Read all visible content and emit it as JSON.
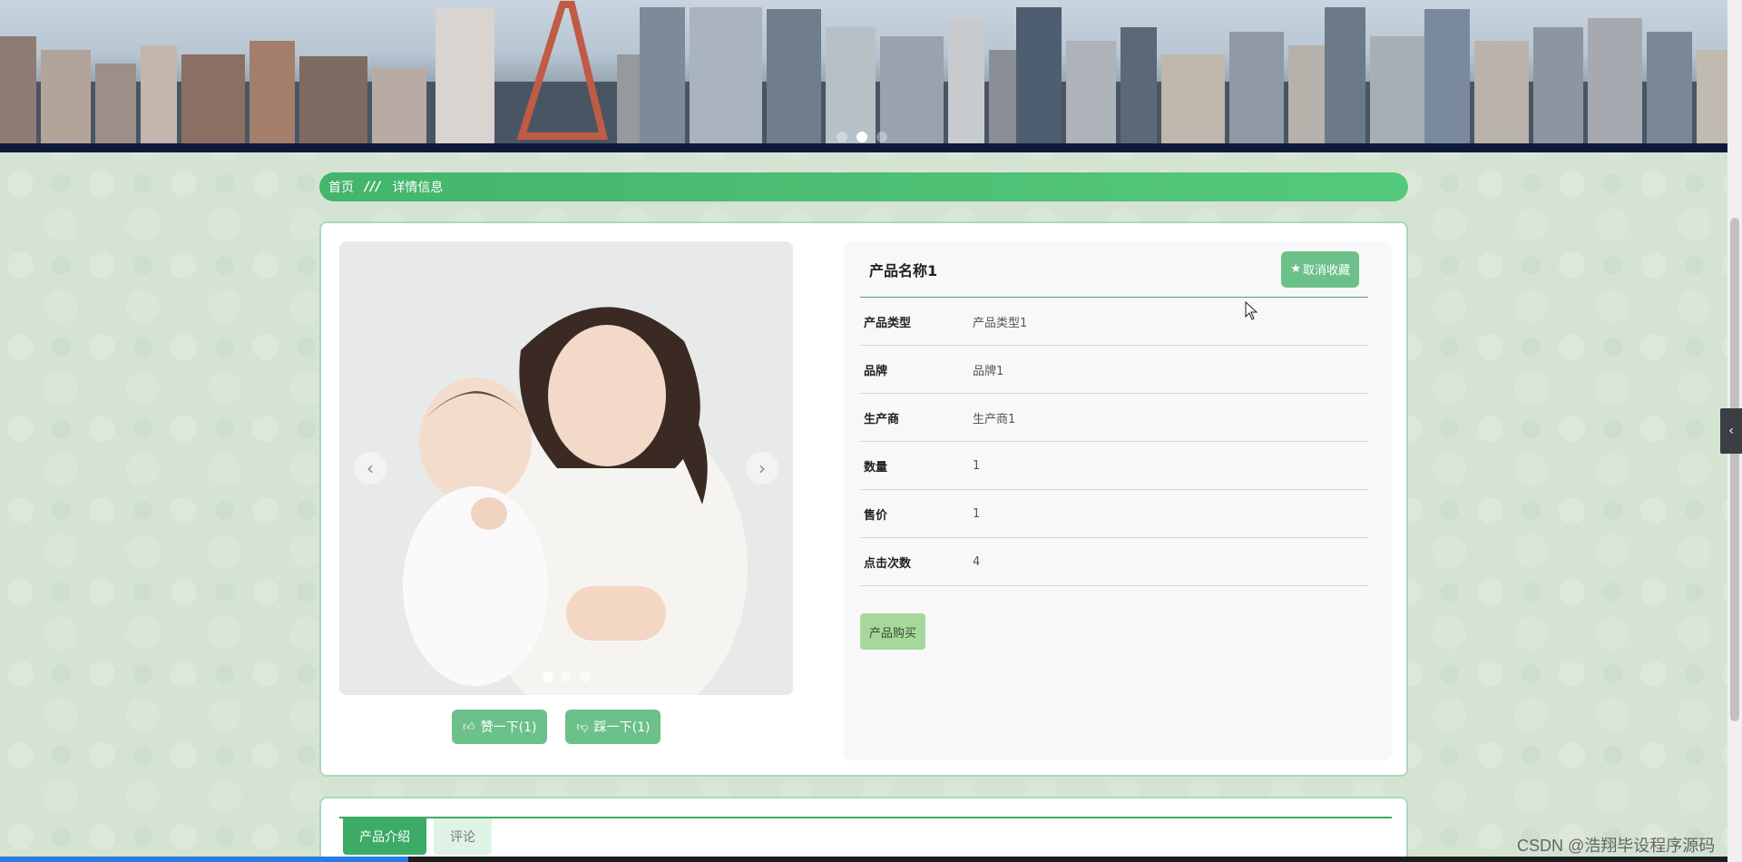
{
  "breadcrumb": {
    "home": "首页",
    "separator": "///",
    "current": "详情信息"
  },
  "product": {
    "title": "产品名称1",
    "favorite_label": "取消收藏",
    "fields": [
      {
        "label": "产品类型",
        "value": "产品类型1"
      },
      {
        "label": "品牌",
        "value": "品牌1"
      },
      {
        "label": "生产商",
        "value": "生产商1"
      },
      {
        "label": "数量",
        "value": "1"
      },
      {
        "label": "售价",
        "value": "1"
      },
      {
        "label": "点击次数",
        "value": "4"
      }
    ],
    "buy_label": "产品购买",
    "like_label": "赞一下(1)",
    "dislike_label": "踩一下(1)"
  },
  "tabs": [
    {
      "label": "产品介绍",
      "active": true
    },
    {
      "label": "评论",
      "active": false
    }
  ],
  "icons": {
    "favorite": "star-icon",
    "like": "thumbs-up-icon",
    "dislike": "thumbs-down-icon",
    "prev": "chevron-left-icon",
    "next": "chevron-right-icon",
    "side_toggle": "chevron-left-icon"
  },
  "colors": {
    "accent": "#43b56c",
    "button": "#6cc08a",
    "buy": "#a6d89b"
  },
  "watermark": "CSDN @浩翔毕设程序源码"
}
